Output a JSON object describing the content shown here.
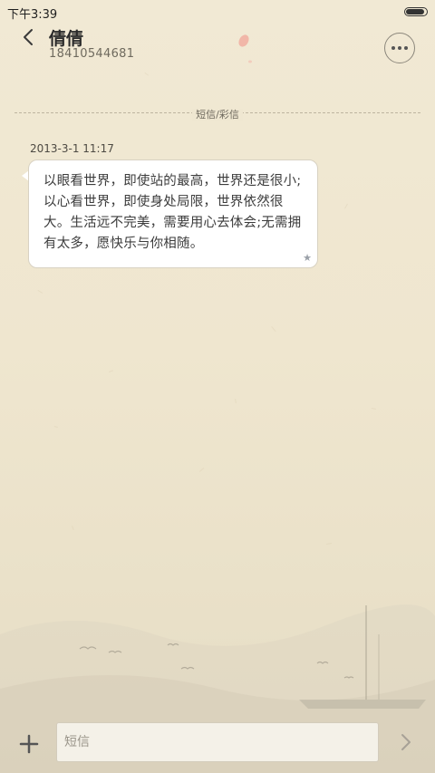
{
  "status_bar": {
    "time": "下午3:39",
    "battery_level": 0.85
  },
  "header": {
    "contact_name": "倩倩",
    "phone_number": "18410544681"
  },
  "thread": {
    "message_type": "短信/彩信",
    "messages": [
      {
        "timestamp": "2013-3-1 11:17",
        "text": "以眼看世界，即使站的最高，世界还是很小;以心看世界，即使身处局限，世界依然很大。生活远不完美，需要用心去体会;无需拥有太多，愿快乐与你相随。",
        "starred": false
      }
    ]
  },
  "composer": {
    "placeholder": "短信",
    "value": ""
  },
  "icons": {
    "back": "chevron-left-icon",
    "more": "more-dots-icon",
    "star": "star-icon",
    "add": "plus-icon",
    "send": "chevron-right-icon"
  }
}
